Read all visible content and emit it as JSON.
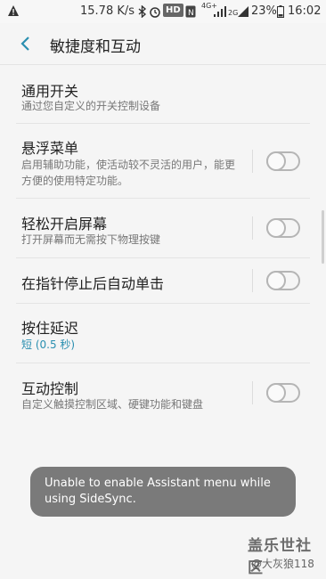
{
  "status_bar": {
    "speed": "15.78 K/s",
    "hd_badge": "HD",
    "network": "4G+",
    "network_secondary": "2G",
    "battery": "23%",
    "time": "16:02",
    "icons": [
      "warning-icon",
      "bluetooth-icon",
      "alarm-icon",
      "nfc-icon",
      "signal-icon",
      "battery-icon"
    ]
  },
  "header": {
    "title": "敏捷度和互动"
  },
  "settings": [
    {
      "title": "通用开关",
      "subtitle": "通过您自定义的开关控制设备",
      "has_toggle": false
    },
    {
      "title": "悬浮菜单",
      "subtitle": "启用辅助功能，使活动较不灵活的用户，能更方便的使用特定功能。",
      "has_toggle": true,
      "enabled": false
    },
    {
      "title": "轻松开启屏幕",
      "subtitle": "打开屏幕而无需按下物理按键",
      "has_toggle": true,
      "enabled": false
    },
    {
      "title": "在指针停止后自动单击",
      "subtitle": "",
      "has_toggle": true,
      "enabled": false
    },
    {
      "title": "按住延迟",
      "subtitle": "短 (0.5 秒)",
      "has_toggle": false
    },
    {
      "title": "互动控制",
      "subtitle": "自定义触摸控制区域、硬键功能和键盘",
      "has_toggle": true,
      "enabled": false
    }
  ],
  "toast": {
    "message": "Unable to enable Assistant menu while using SideSync."
  },
  "watermark": {
    "logo": "盖乐世社区",
    "user": "@大灰狼118"
  },
  "colors": {
    "accent": "#2a8fb0",
    "background": "#f5f5f5",
    "toast_bg": "#7a7a7a"
  }
}
